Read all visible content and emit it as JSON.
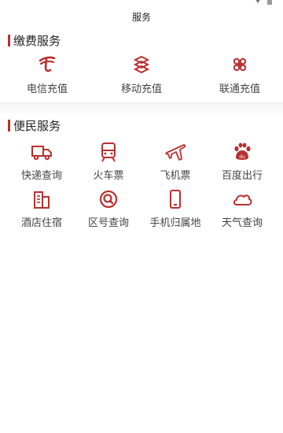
{
  "header": {
    "title": "服务"
  },
  "colors": {
    "accent": "#b9302f",
    "text": "#444444"
  },
  "payment_section": {
    "title": "缴费服务",
    "items": [
      {
        "label": "电信充值",
        "icon": "china-telecom-icon"
      },
      {
        "label": "移动充值",
        "icon": "china-mobile-icon"
      },
      {
        "label": "联通充值",
        "icon": "china-unicom-icon"
      }
    ]
  },
  "convenience_section": {
    "title": "便民服务",
    "items": [
      {
        "label": "快递查询",
        "icon": "truck-icon"
      },
      {
        "label": "火车票",
        "icon": "train-icon"
      },
      {
        "label": "飞机票",
        "icon": "plane-icon"
      },
      {
        "label": "百度出行",
        "icon": "baidu-paw-icon"
      },
      {
        "label": "酒店住宿",
        "icon": "hotel-building-icon"
      },
      {
        "label": "区号查询",
        "icon": "area-code-search-icon"
      },
      {
        "label": "手机归属地",
        "icon": "phone-icon"
      },
      {
        "label": "天气查询",
        "icon": "cloud-icon"
      }
    ]
  }
}
